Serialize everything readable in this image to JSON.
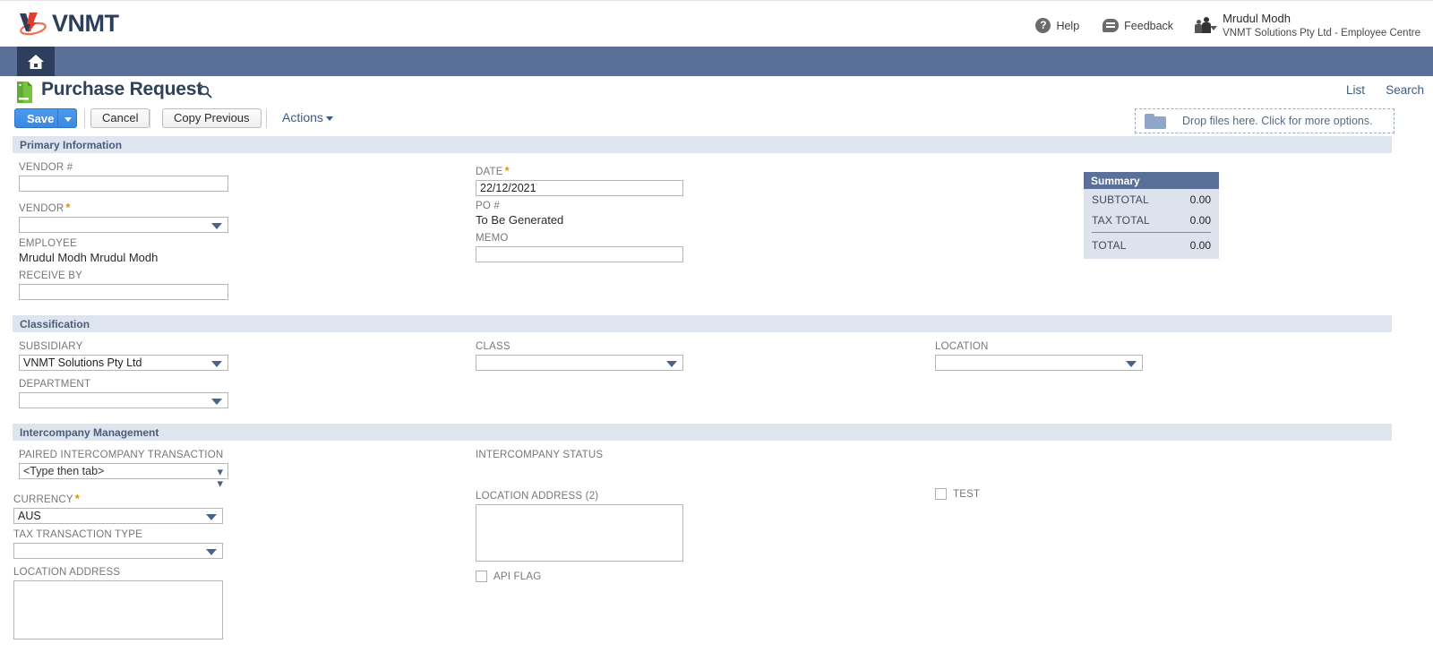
{
  "app": {
    "logo_text": "VNMT",
    "logo_icon": "vnmt-logo-icon"
  },
  "header": {
    "help_label": "Help",
    "feedback_label": "Feedback",
    "user_name": "Mrudul Modh",
    "user_role": "VNMT Solutions Pty Ltd - Employee Centre"
  },
  "nav": {
    "home_icon": "home-icon"
  },
  "title_row": {
    "title": "Purchase Request",
    "doc_icon": "document-icon",
    "search_icon": "magnifier-icon",
    "list_label": "List",
    "search_label": "Search"
  },
  "toolbar": {
    "save_label": "Save",
    "cancel_label": "Cancel",
    "copy_previous_label": "Copy Previous",
    "actions_label": "Actions"
  },
  "dropzone": {
    "text": "Drop files here. Click for more options.",
    "icon": "folder-icon"
  },
  "sections": {
    "primary": "Primary Information",
    "classification": "Classification",
    "intercompany": "Intercompany Management"
  },
  "primary": {
    "vendor_num_label": "VENDOR #",
    "vendor_num_value": "",
    "vendor_label": "VENDOR",
    "vendor_value": "",
    "employee_label": "EMPLOYEE",
    "employee_value": "Mrudul Modh Mrudul Modh",
    "receive_by_label": "RECEIVE BY",
    "receive_by_value": "",
    "date_label": "DATE",
    "date_value": "22/12/2021",
    "po_label": "PO #",
    "po_value": "To Be Generated",
    "memo_label": "MEMO",
    "memo_value": ""
  },
  "summary": {
    "title": "Summary",
    "rows": [
      {
        "label": "SUBTOTAL",
        "value": "0.00"
      },
      {
        "label": "TAX TOTAL",
        "value": "0.00"
      }
    ],
    "total_label": "TOTAL",
    "total_value": "0.00"
  },
  "classification": {
    "subsidiary_label": "SUBSIDIARY",
    "subsidiary_value": "VNMT Solutions Pty Ltd",
    "department_label": "DEPARTMENT",
    "department_value": "",
    "class_label": "CLASS",
    "class_value": "",
    "location_label": "LOCATION",
    "location_value": ""
  },
  "intercompany": {
    "paired_label": "PAIRED INTERCOMPANY TRANSACTION",
    "paired_value": "<Type then tab>",
    "currency_label": "CURRENCY",
    "currency_value": "AUS",
    "tax_type_label": "TAX TRANSACTION TYPE",
    "tax_type_value": "",
    "location_address_label": "LOCATION ADDRESS",
    "location_address_value": "",
    "status_label": "INTERCOMPANY STATUS",
    "status_value": "",
    "location_address2_label": "LOCATION ADDRESS (2)",
    "location_address2_value": "",
    "api_flag_label": "API FLAG",
    "test_label": "TEST"
  },
  "colors": {
    "nav_blue": "#5b7099",
    "nav_active": "#2d3e5f",
    "section_header_bg": "#dfe5ef",
    "accent_link": "#3c5a80",
    "required_star": "#e0930f",
    "save_button": "#3b88e0"
  }
}
